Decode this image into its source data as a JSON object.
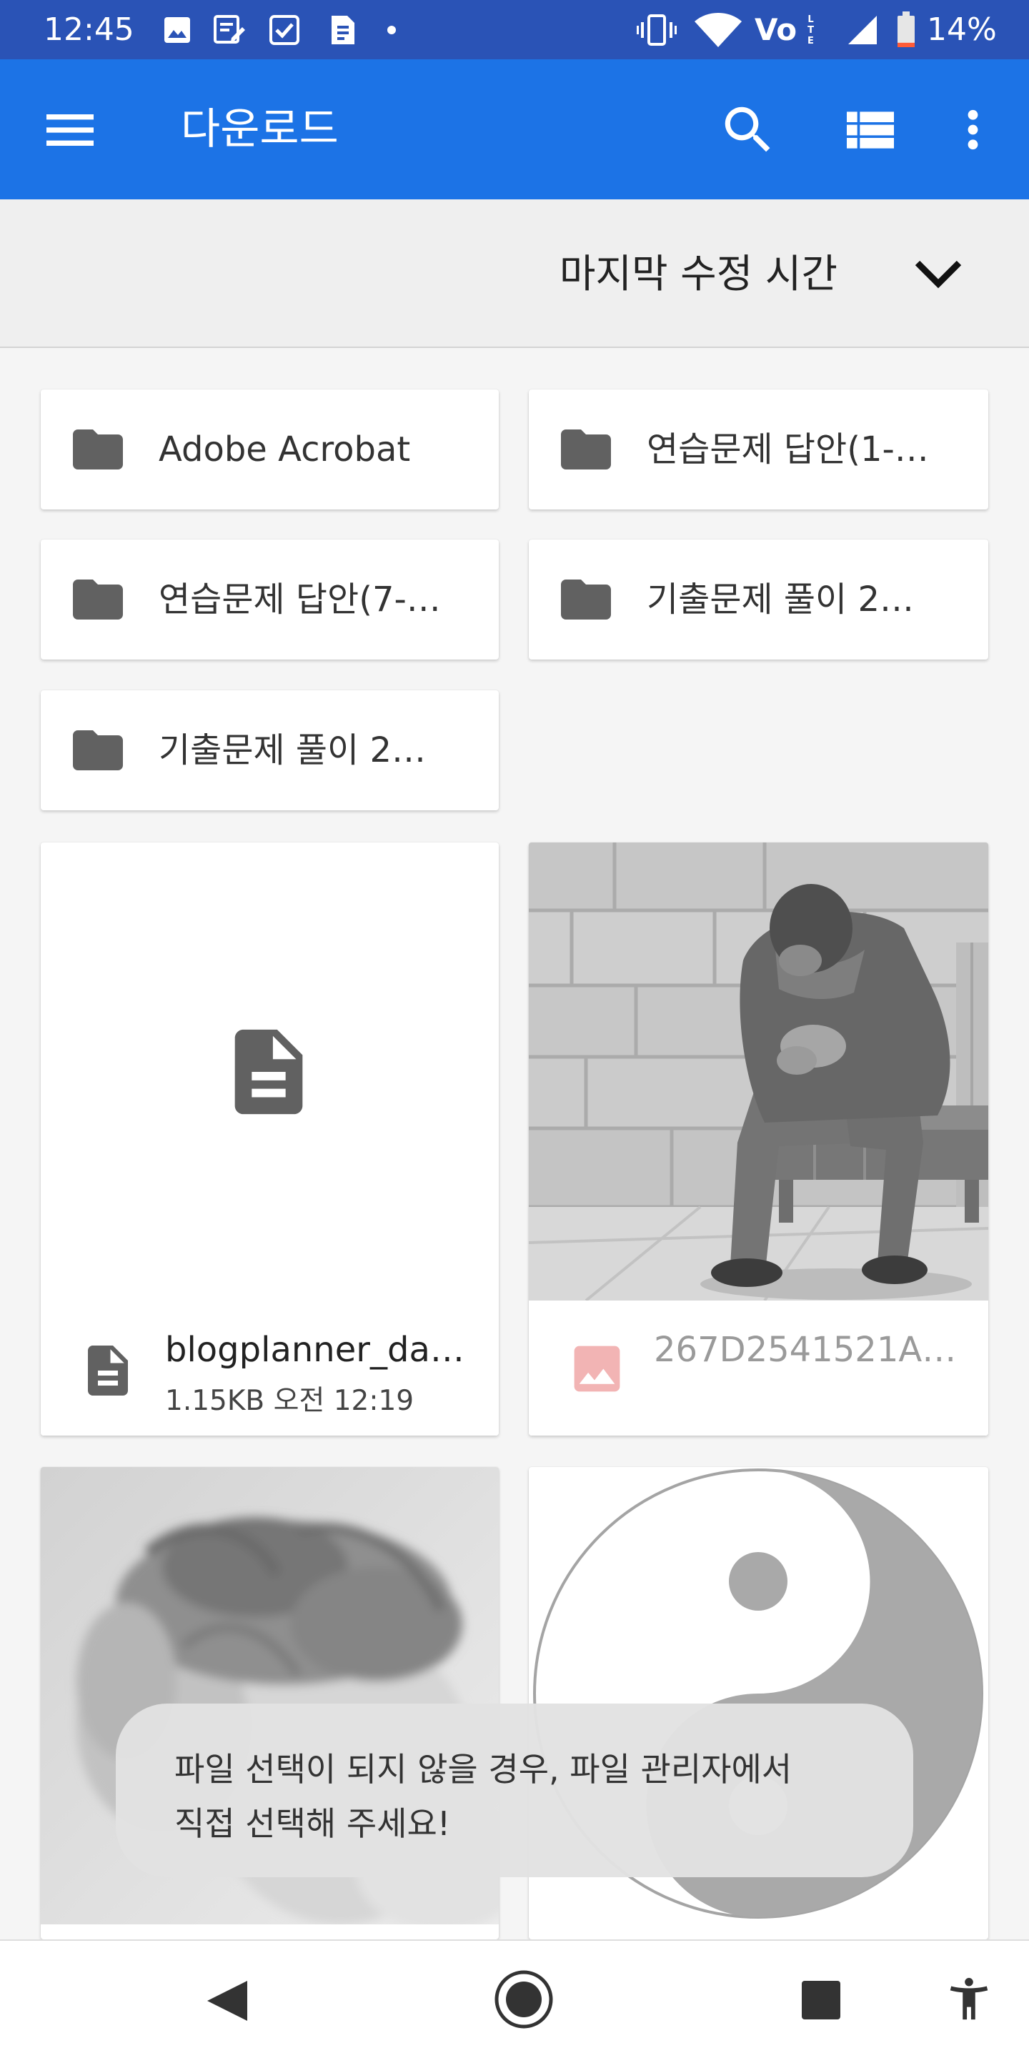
{
  "status_bar": {
    "time": "12:45",
    "network_label": "Vo",
    "network_sub_label": "LTE",
    "battery_text": "14%",
    "battery_level": 0.14,
    "left_icons": [
      "image-icon",
      "note-icon",
      "checkbox-icon",
      "sim-icon",
      "dot-icon"
    ],
    "right_icons": [
      "vibrate-icon",
      "wifi-icon",
      "signal-icon",
      "battery-icon"
    ]
  },
  "app_bar": {
    "title": "다운로드",
    "icons": [
      "menu-icon",
      "search-icon",
      "list-view-icon",
      "more-vert-icon"
    ]
  },
  "sort": {
    "label": "마지막 수정 시간",
    "icon": "chevron-down-icon"
  },
  "folders": [
    {
      "name": "Adobe Acrobat"
    },
    {
      "name": "연습문제 답안(1-…"
    },
    {
      "name": "연습문제 답안(7-…"
    },
    {
      "name": "기출문제 풀이 2…"
    },
    {
      "name": "기출문제 풀이 2…"
    }
  ],
  "files": [
    {
      "type": "document",
      "name": "blogplanner_da…",
      "meta": "1.15KB 오전 12:19"
    },
    {
      "type": "image",
      "name": "267D2541521A…"
    },
    {
      "type": "image"
    },
    {
      "type": "image"
    }
  ],
  "toast": {
    "lines": [
      "파일 선택이 되지 않을 경우, 파일 관리자에서",
      "직접 선택해 주세요!"
    ]
  },
  "nav_bar": {
    "icons": [
      "back-icon",
      "home-icon",
      "recents-icon",
      "accessibility-icon"
    ]
  },
  "colors": {
    "status_bar": "#2a53b6",
    "app_bar": "#1c73e6",
    "sort_bar": "#efefef",
    "background": "#f5f5f5",
    "icon_gray": "#616161",
    "battery_low": "#ff5b37",
    "image_placeholder_icon": "#f2b4b4"
  }
}
